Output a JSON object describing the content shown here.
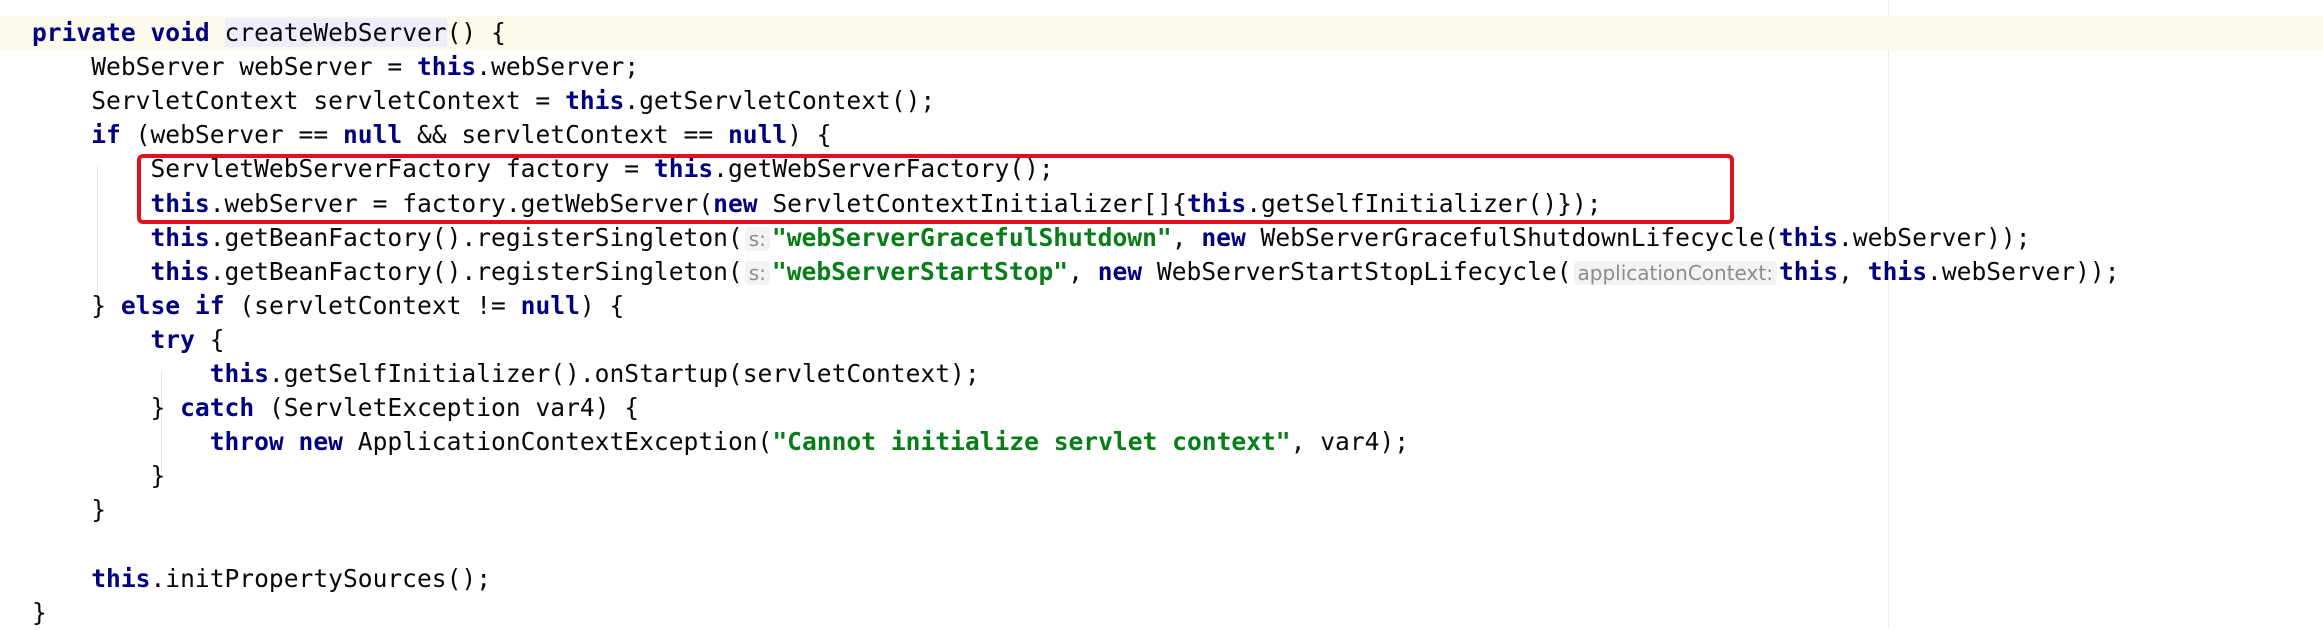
{
  "editor": {
    "lines": [
      {
        "indent": "",
        "segments": [
          {
            "text": "private",
            "cls": "kw"
          },
          {
            "text": " "
          },
          {
            "text": "void",
            "cls": "kw"
          },
          {
            "text": " "
          },
          {
            "text": "createWebServer",
            "cls": "hl-name"
          },
          {
            "text": "() {"
          }
        ]
      },
      {
        "indent": "    ",
        "segments": [
          {
            "text": "WebServer webServer = "
          },
          {
            "text": "this",
            "cls": "kw"
          },
          {
            "text": ".webServer;"
          }
        ]
      },
      {
        "indent": "    ",
        "segments": [
          {
            "text": "ServletContext servletContext = "
          },
          {
            "text": "this",
            "cls": "kw"
          },
          {
            "text": ".getServletContext();"
          }
        ]
      },
      {
        "indent": "    ",
        "segments": [
          {
            "text": "if",
            "cls": "kw"
          },
          {
            "text": " (webServer == "
          },
          {
            "text": "null",
            "cls": "kw"
          },
          {
            "text": " && servletContext == "
          },
          {
            "text": "null",
            "cls": "kw"
          },
          {
            "text": ") {"
          }
        ]
      },
      {
        "indent": "        ",
        "segments": [
          {
            "text": "ServletWebServerFactory factory = "
          },
          {
            "text": "this",
            "cls": "kw"
          },
          {
            "text": ".getWebServerFactory();"
          }
        ]
      },
      {
        "indent": "        ",
        "segments": [
          {
            "text": "this",
            "cls": "kw"
          },
          {
            "text": ".webServer = factory.getWebServer("
          },
          {
            "text": "new",
            "cls": "kw"
          },
          {
            "text": " ServletContextInitializer[]{"
          },
          {
            "text": "this",
            "cls": "kw"
          },
          {
            "text": ".getSelfInitializer()});"
          }
        ]
      },
      {
        "indent": "        ",
        "segments": [
          {
            "text": "this",
            "cls": "kw"
          },
          {
            "text": ".getBeanFactory().registerSingleton("
          },
          {
            "text": "s:",
            "cls": "hint"
          },
          {
            "text": "\"webServerGracefulShutdown\"",
            "cls": "str"
          },
          {
            "text": ", "
          },
          {
            "text": "new",
            "cls": "kw"
          },
          {
            "text": " WebServerGracefulShutdownLifecycle("
          },
          {
            "text": "this",
            "cls": "kw"
          },
          {
            "text": ".webServer));"
          }
        ]
      },
      {
        "indent": "        ",
        "segments": [
          {
            "text": "this",
            "cls": "kw"
          },
          {
            "text": ".getBeanFactory().registerSingleton("
          },
          {
            "text": "s:",
            "cls": "hint"
          },
          {
            "text": "\"webServerStartStop\"",
            "cls": "str"
          },
          {
            "text": ", "
          },
          {
            "text": "new",
            "cls": "kw"
          },
          {
            "text": " WebServerStartStopLifecycle("
          },
          {
            "text": "applicationContext:",
            "cls": "hint"
          },
          {
            "text": "this",
            "cls": "kw"
          },
          {
            "text": ", "
          },
          {
            "text": "this",
            "cls": "kw"
          },
          {
            "text": ".webServer));"
          }
        ]
      },
      {
        "indent": "    ",
        "segments": [
          {
            "text": "} "
          },
          {
            "text": "else",
            "cls": "kw"
          },
          {
            "text": " "
          },
          {
            "text": "if",
            "cls": "kw"
          },
          {
            "text": " (servletContext != "
          },
          {
            "text": "null",
            "cls": "kw"
          },
          {
            "text": ") {"
          }
        ]
      },
      {
        "indent": "        ",
        "segments": [
          {
            "text": "try",
            "cls": "kw"
          },
          {
            "text": " {"
          }
        ]
      },
      {
        "indent": "            ",
        "segments": [
          {
            "text": "this",
            "cls": "kw"
          },
          {
            "text": ".getSelfInitializer().onStartup(servletContext);"
          }
        ]
      },
      {
        "indent": "        ",
        "segments": [
          {
            "text": "} "
          },
          {
            "text": "catch",
            "cls": "kw"
          },
          {
            "text": " (ServletException var4) {"
          }
        ]
      },
      {
        "indent": "            ",
        "segments": [
          {
            "text": "throw",
            "cls": "kw"
          },
          {
            "text": " "
          },
          {
            "text": "new",
            "cls": "kw"
          },
          {
            "text": " ApplicationContextException("
          },
          {
            "text": "\"Cannot initialize servlet context\"",
            "cls": "str"
          },
          {
            "text": ", var4);"
          }
        ]
      },
      {
        "indent": "        ",
        "segments": [
          {
            "text": "}"
          }
        ]
      },
      {
        "indent": "    ",
        "segments": [
          {
            "text": "}"
          }
        ]
      },
      {
        "indent": "",
        "segments": []
      },
      {
        "indent": "    ",
        "segments": [
          {
            "text": "this",
            "cls": "kw"
          },
          {
            "text": ".initPropertySources();"
          }
        ]
      },
      {
        "indent": "",
        "segments": [
          {
            "text": "}"
          }
        ]
      }
    ]
  },
  "colors": {
    "keyword": "#000080",
    "string": "#067d17",
    "highlight_box": "#e0101c",
    "current_line": "#fcfaed"
  }
}
